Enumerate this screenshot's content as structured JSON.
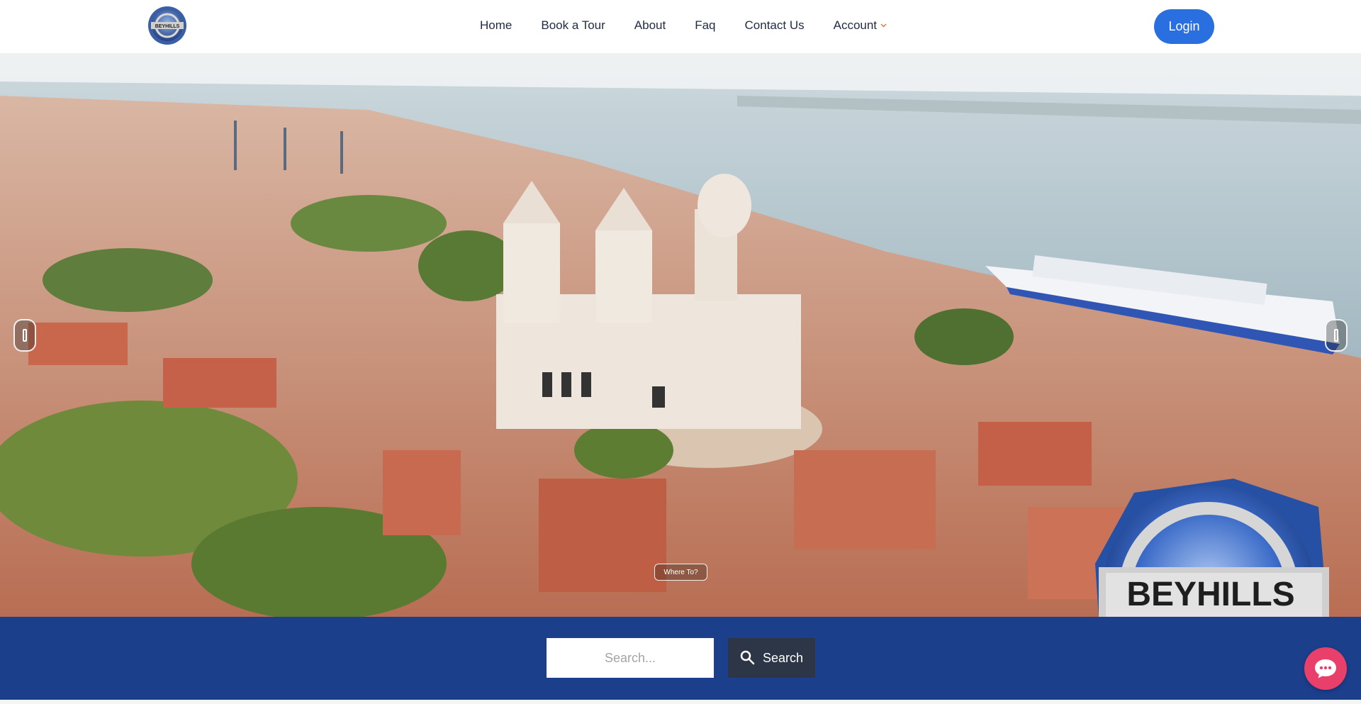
{
  "brand": {
    "logo_text": "BEYHILLS"
  },
  "nav": {
    "items": [
      {
        "label": "Home"
      },
      {
        "label": "Book a Tour"
      },
      {
        "label": "About"
      },
      {
        "label": "Faq"
      },
      {
        "label": "Contact Us"
      },
      {
        "label": "Account",
        "has_dropdown": true
      }
    ],
    "login_label": "Login"
  },
  "hero": {
    "badge_text": "Where To?",
    "watermark_text": "BEYHILLS",
    "prev_icon": "chevron-left-icon",
    "next_icon": "chevron-right-icon"
  },
  "search": {
    "placeholder": "Search...",
    "button_label": "Search",
    "icon": "search-icon"
  },
  "chat": {
    "icon": "chat-bubble-icon"
  },
  "colors": {
    "primary": "#2a6fdf",
    "band": "#1c3f8c",
    "search_button": "#2c3646",
    "chat": "#e9406b",
    "nav_text": "#1f2a44"
  }
}
